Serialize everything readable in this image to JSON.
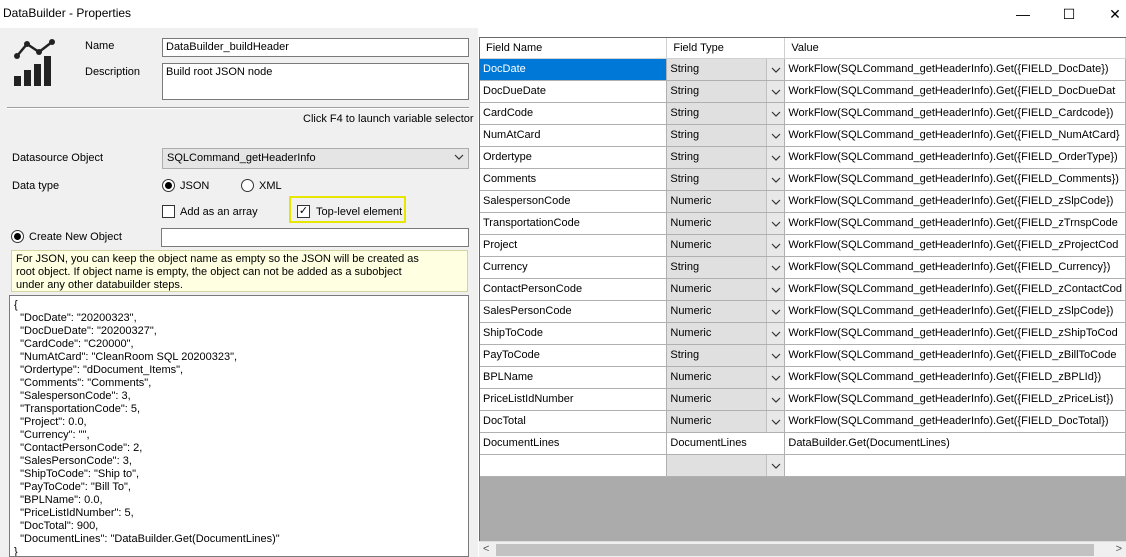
{
  "window": {
    "title": "DataBuilder - Properties",
    "minimize": "—",
    "maximize": "☐",
    "close": "✕"
  },
  "form": {
    "name_label": "Name",
    "name_value": "DataBuilder_buildHeader",
    "description_label": "Description",
    "description_value": "Build root JSON node",
    "hint": "Click F4 to launch variable selector",
    "datasource_label": "Datasource Object",
    "datasource_value": "SQLCommand_getHeaderInfo",
    "datatype_label": "Data type",
    "json_label": "JSON",
    "xml_label": "XML",
    "datatype_selected": "JSON",
    "array_label": "Add as an array",
    "array_checked": false,
    "toplevel_label": "Top-level element",
    "toplevel_checked": true,
    "create_label": "Create New Object",
    "create_value": "",
    "info": "For JSON, you can keep the object name as empty so the JSON will be created as\nroot object.  If object name is empty, the object can not be added as a subobject\nunder any other databuilder steps.",
    "json_preview": "{\n  \"DocDate\": \"20200323\",\n  \"DocDueDate\": \"20200327\",\n  \"CardCode\": \"C20000\",\n  \"NumAtCard\": \"CleanRoom SQL 20200323\",\n  \"Ordertype\": \"dDocument_Items\",\n  \"Comments\": \"Comments\",\n  \"SalespersonCode\": 3,\n  \"TransportationCode\": 5,\n  \"Project\": 0.0,\n  \"Currency\": \"\",\n  \"ContactPersonCode\": 2,\n  \"SalesPersonCode\": 3,\n  \"ShipToCode\": \"Ship to\",\n  \"PayToCode\": \"Bill To\",\n  \"BPLName\": 0.0,\n  \"PriceListIdNumber\": 5,\n  \"DocTotal\": 900,\n  \"DocumentLines\": \"DataBuilder.Get(DocumentLines)\"\n}"
  },
  "grid": {
    "headers": [
      "Field Name",
      "Field Type",
      "Value"
    ],
    "rows": [
      {
        "name": "DocDate",
        "type": "String",
        "value": "WorkFlow(SQLCommand_getHeaderInfo).Get({FIELD_DocDate})"
      },
      {
        "name": "DocDueDate",
        "type": "String",
        "value": "WorkFlow(SQLCommand_getHeaderInfo).Get({FIELD_DocDueDat"
      },
      {
        "name": "CardCode",
        "type": "String",
        "value": "WorkFlow(SQLCommand_getHeaderInfo).Get({FIELD_Cardcode})"
      },
      {
        "name": "NumAtCard",
        "type": "String",
        "value": "WorkFlow(SQLCommand_getHeaderInfo).Get({FIELD_NumAtCard}"
      },
      {
        "name": "Ordertype",
        "type": "String",
        "value": "WorkFlow(SQLCommand_getHeaderInfo).Get({FIELD_OrderType})"
      },
      {
        "name": "Comments",
        "type": "String",
        "value": "WorkFlow(SQLCommand_getHeaderInfo).Get({FIELD_Comments})"
      },
      {
        "name": "SalespersonCode",
        "type": "Numeric",
        "value": "WorkFlow(SQLCommand_getHeaderInfo).Get({FIELD_zSlpCode})"
      },
      {
        "name": "TransportationCode",
        "type": "Numeric",
        "value": "WorkFlow(SQLCommand_getHeaderInfo).Get({FIELD_zTrnspCode"
      },
      {
        "name": "Project",
        "type": "Numeric",
        "value": "WorkFlow(SQLCommand_getHeaderInfo).Get({FIELD_zProjectCod"
      },
      {
        "name": "Currency",
        "type": "String",
        "value": "WorkFlow(SQLCommand_getHeaderInfo).Get({FIELD_Currency})"
      },
      {
        "name": "ContactPersonCode",
        "type": "Numeric",
        "value": "WorkFlow(SQLCommand_getHeaderInfo).Get({FIELD_zContactCod"
      },
      {
        "name": "SalesPersonCode",
        "type": "Numeric",
        "value": "WorkFlow(SQLCommand_getHeaderInfo).Get({FIELD_zSlpCode})"
      },
      {
        "name": "ShipToCode",
        "type": "Numeric",
        "value": "WorkFlow(SQLCommand_getHeaderInfo).Get({FIELD_zShipToCod"
      },
      {
        "name": "PayToCode",
        "type": "String",
        "value": "WorkFlow(SQLCommand_getHeaderInfo).Get({FIELD_zBillToCode"
      },
      {
        "name": "BPLName",
        "type": "Numeric",
        "value": "WorkFlow(SQLCommand_getHeaderInfo).Get({FIELD_zBPLId})"
      },
      {
        "name": "PriceListIdNumber",
        "type": "Numeric",
        "value": "WorkFlow(SQLCommand_getHeaderInfo).Get({FIELD_zPriceList})"
      },
      {
        "name": "DocTotal",
        "type": "Numeric",
        "value": "WorkFlow(SQLCommand_getHeaderInfo).Get({FIELD_DocTotal})"
      },
      {
        "name": "DocumentLines",
        "type": "DocumentLines",
        "value": "DataBuilder.Get(DocumentLines)"
      },
      {
        "name": "",
        "type": "",
        "value": ""
      }
    ],
    "selected_row": 0
  },
  "scrollbar": {
    "left_arrow": "<",
    "right_arrow": ">"
  },
  "icons": {
    "logo": "chart-network-icon",
    "dropdown": "chevron-down-icon"
  },
  "colors": {
    "selection": "#0078d7",
    "highlight_box": "#e6e600",
    "info_background": "#ffffe1"
  }
}
